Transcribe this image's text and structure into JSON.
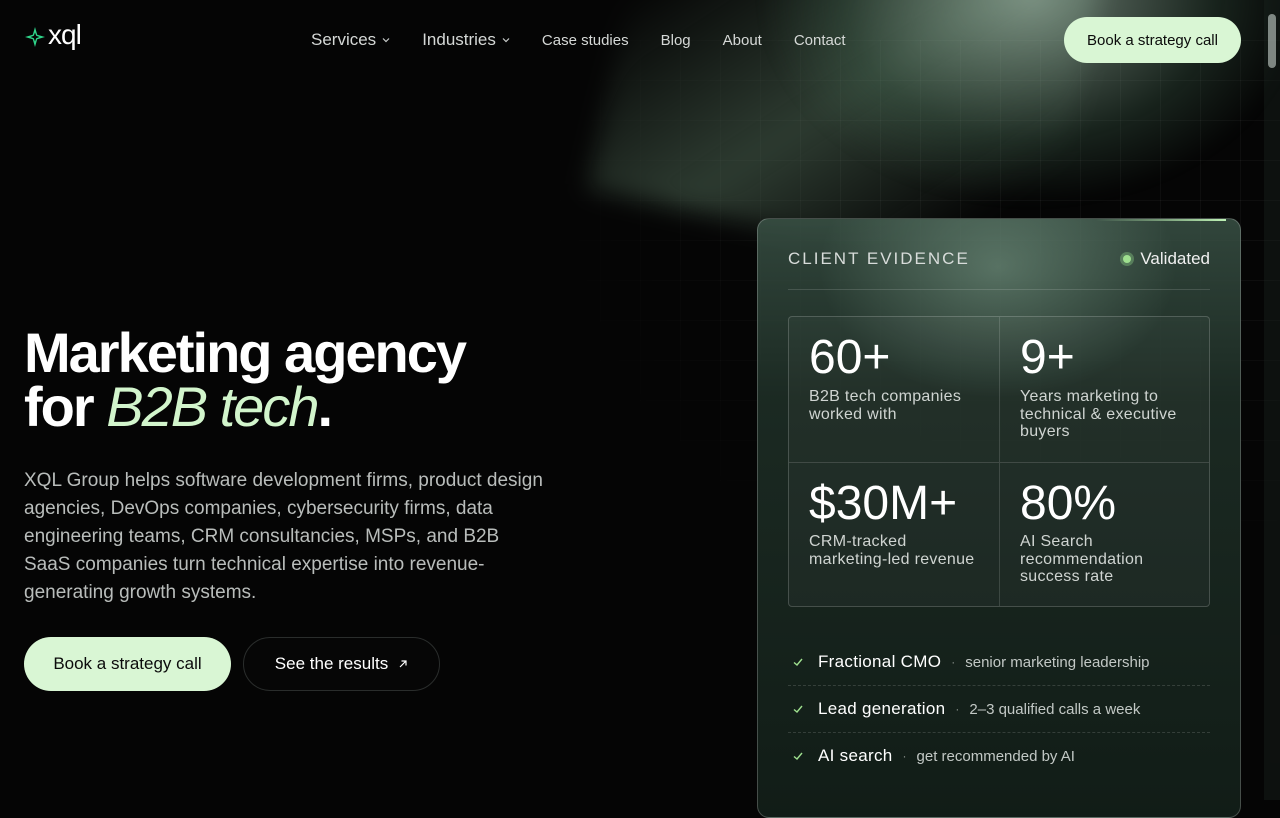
{
  "brand": {
    "name": "xql",
    "accent": "#2fd58a"
  },
  "nav": {
    "items": [
      {
        "label": "Services",
        "dropdown": true
      },
      {
        "label": "Industries",
        "dropdown": true
      },
      {
        "label": "Case studies"
      },
      {
        "label": "Blog"
      },
      {
        "label": "About"
      },
      {
        "label": "Contact"
      }
    ],
    "cta": "Book a strategy call"
  },
  "hero": {
    "title_line1": "Marketing agency",
    "title_line2_prefix": "for ",
    "title_accent": "B2B tech",
    "title_suffix": ".",
    "body": "XQL Group helps software development firms, product design agencies, DevOps companies, cybersecurity firms, data engineering teams, CRM consultancies, MSPs, and B2B SaaS companies turn technical expertise into revenue-generating growth systems.",
    "primary_button": "Book a strategy call",
    "secondary_button": "See the results",
    "secondary_icon": "arrow-up-right-icon"
  },
  "card": {
    "title": "CLIENT EVIDENCE",
    "status": "Validated",
    "status_color": "#9fe08f",
    "stats": [
      {
        "value": "60+",
        "label": "B2B tech companies worked with"
      },
      {
        "value": "9+",
        "label": "Years marketing to technical & executive buyers"
      },
      {
        "value": "$30M+",
        "label": "CRM-tracked marketing-led revenue"
      },
      {
        "value": "80%",
        "label": "AI Search recommendation success rate"
      }
    ],
    "services": [
      {
        "name": "Fractional CMO",
        "desc": "senior marketing leadership"
      },
      {
        "name": "Lead generation",
        "desc": "2–3 qualified calls a week"
      },
      {
        "name": "AI search",
        "desc": "get recommended by AI"
      }
    ]
  },
  "colors": {
    "background": "#050505",
    "button_bg": "#d9f6d4",
    "accent_text": "#d2f5cc"
  }
}
